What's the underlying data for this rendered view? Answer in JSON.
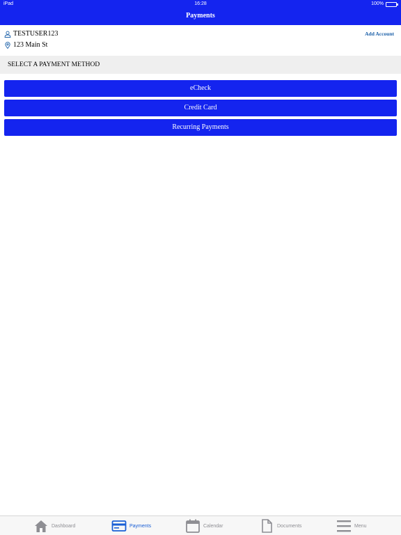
{
  "status_bar": {
    "device": "iPad",
    "time": "16:28",
    "battery": "100%"
  },
  "header": {
    "title": "Payments"
  },
  "account": {
    "username": "TESTUSER123",
    "address": "123 Main St",
    "add_account_label": "Add Account"
  },
  "section": {
    "title": "SELECT A PAYMENT METHOD"
  },
  "payment_methods": [
    {
      "label": "eCheck"
    },
    {
      "label": "Credit Card"
    },
    {
      "label": "Recurring Payments"
    }
  ],
  "tabs": [
    {
      "label": "Dashboard",
      "icon": "home-icon"
    },
    {
      "label": "Payments",
      "icon": "credit-card-icon",
      "active": true
    },
    {
      "label": "Calendar",
      "icon": "calendar-icon"
    },
    {
      "label": "Documents",
      "icon": "document-icon"
    },
    {
      "label": "Menu",
      "icon": "menu-icon"
    }
  ],
  "colors": {
    "primary": "#1424ef",
    "link": "#1a5fa8",
    "tab_active": "#1a5fd6",
    "tab_inactive": "#8e8e93",
    "section_bg": "#efefef"
  }
}
